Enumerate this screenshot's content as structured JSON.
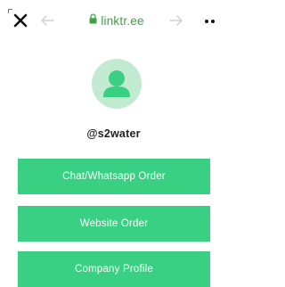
{
  "browser": {
    "url": "linktr.ee",
    "icons": {
      "close": "close-icon",
      "back": "arrow-left-icon",
      "forward": "arrow-right-icon",
      "lock": "lock-icon",
      "more": "more-icon"
    },
    "url_color": "#3fa142"
  },
  "profile": {
    "username": "@s2water",
    "avatar_color": "#c2ead1",
    "avatar_icon_color": "#39d083"
  },
  "links": [
    {
      "label": "Chat/Whatsapp Order"
    },
    {
      "label": "Website Order"
    },
    {
      "label": "Company Profile"
    }
  ],
  "colors": {
    "button_bg": "#39d083",
    "button_text": "#ffffff"
  }
}
